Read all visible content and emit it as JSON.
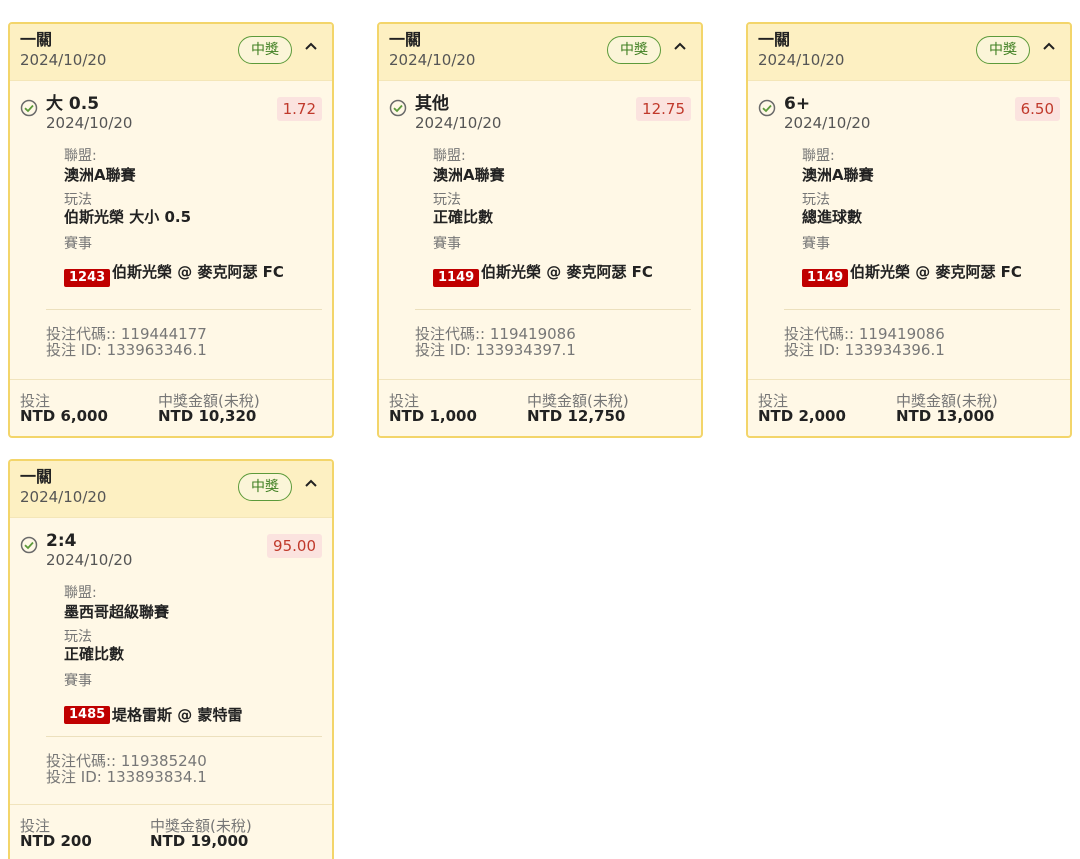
{
  "cards": [
    {
      "title": "一關",
      "date": "2024/10/20",
      "status": "中獎",
      "selection": "大 0.5",
      "selection_date": "2024/10/20",
      "odds": "1.72",
      "league_label": "聯盟:",
      "league": "澳洲A聯賽",
      "market_label": "玩法",
      "market": "伯斯光榮 大小 0.5",
      "event_label": "賽事",
      "event_id": "1243",
      "event": "伯斯光榮 @ 麥克阿瑟 FC",
      "bet_code": "投注代碼:: 119444177",
      "bet_id": "投注 ID: 133963346.1",
      "stake_label": "投注",
      "stake": "NTD 6,000",
      "payout_label": "中獎金額(未稅)",
      "payout": "NTD 10,320"
    },
    {
      "title": "一關",
      "date": "2024/10/20",
      "status": "中獎",
      "selection": "其他",
      "selection_date": "2024/10/20",
      "odds": "12.75",
      "league_label": "聯盟:",
      "league": "澳洲A聯賽",
      "market_label": "玩法",
      "market": "正確比數",
      "event_label": "賽事",
      "event_id": "1149",
      "event": "伯斯光榮 @ 麥克阿瑟 FC",
      "bet_code": "投注代碼:: 119419086",
      "bet_id": "投注 ID: 133934397.1",
      "stake_label": "投注",
      "stake": "NTD 1,000",
      "payout_label": "中獎金額(未稅)",
      "payout": "NTD 12,750"
    },
    {
      "title": "一關",
      "date": "2024/10/20",
      "status": "中獎",
      "selection": "6+",
      "selection_date": "2024/10/20",
      "odds": "6.50",
      "league_label": "聯盟:",
      "league": "澳洲A聯賽",
      "market_label": "玩法",
      "market": "總進球數",
      "event_label": "賽事",
      "event_id": "1149",
      "event": "伯斯光榮 @ 麥克阿瑟 FC",
      "bet_code": "投注代碼:: 119419086",
      "bet_id": "投注 ID: 133934396.1",
      "stake_label": "投注",
      "stake": "NTD 2,000",
      "payout_label": "中獎金額(未稅)",
      "payout": "NTD 13,000"
    },
    {
      "title": "一關",
      "date": "2024/10/20",
      "status": "中獎",
      "selection": "2:4",
      "selection_date": "2024/10/20",
      "odds": "95.00",
      "league_label": "聯盟:",
      "league": "墨西哥超級聯賽",
      "market_label": "玩法",
      "market": "正確比數",
      "event_label": "賽事",
      "event_id": "1485",
      "event": "堤格雷斯 @ 蒙特雷",
      "bet_code": "投注代碼:: 119385240",
      "bet_id": "投注 ID: 133893834.1",
      "stake_label": "投注",
      "stake": "NTD 200",
      "payout_label": "中獎金額(未稅)",
      "payout": "NTD 19,000"
    }
  ],
  "colors": {
    "border": "#f3d56a",
    "header_bg": "#fdf0c2",
    "body_bg": "#fff8e6",
    "win_green": "#5c9a3a",
    "odds_red": "#c0392b",
    "match_id_bg": "#c00000"
  },
  "icons": {
    "check": "check-circle-icon",
    "collapse": "chevron-up-icon"
  }
}
